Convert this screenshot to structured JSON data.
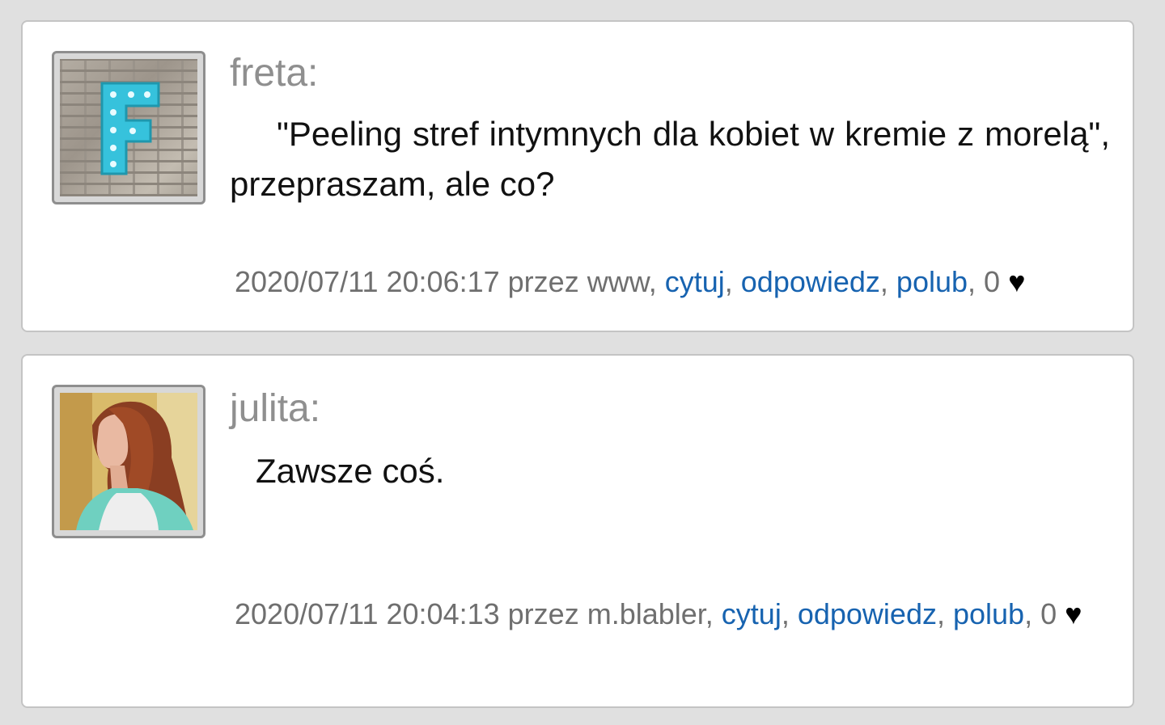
{
  "comments": [
    {
      "author": "freta:",
      "text": "\"Peeling stref intymnych dla kobiet w kremie z morelą\", przepraszam, ale co?",
      "timestamp": "2020/07/11 20:06:17",
      "via_prefix": "przez",
      "via": "www",
      "quote_label": "cytuj",
      "reply_label": "odpowiedz",
      "like_label": "polub",
      "like_count": "0",
      "heart": "♥",
      "avatar_letter": "F"
    },
    {
      "author": "julita:",
      "text": "Zawsze coś.",
      "timestamp": "2020/07/11 20:04:13",
      "via_prefix": "przez",
      "via": "m.blabler",
      "quote_label": "cytuj",
      "reply_label": "odpowiedz",
      "like_label": "polub",
      "like_count": "0",
      "heart": "♥"
    }
  ],
  "colors": {
    "page_background": "#e0e0e0",
    "card_background": "#ffffff",
    "link": "#1763b0",
    "author": "#8f8f8f",
    "meta": "#6f6f6f"
  }
}
